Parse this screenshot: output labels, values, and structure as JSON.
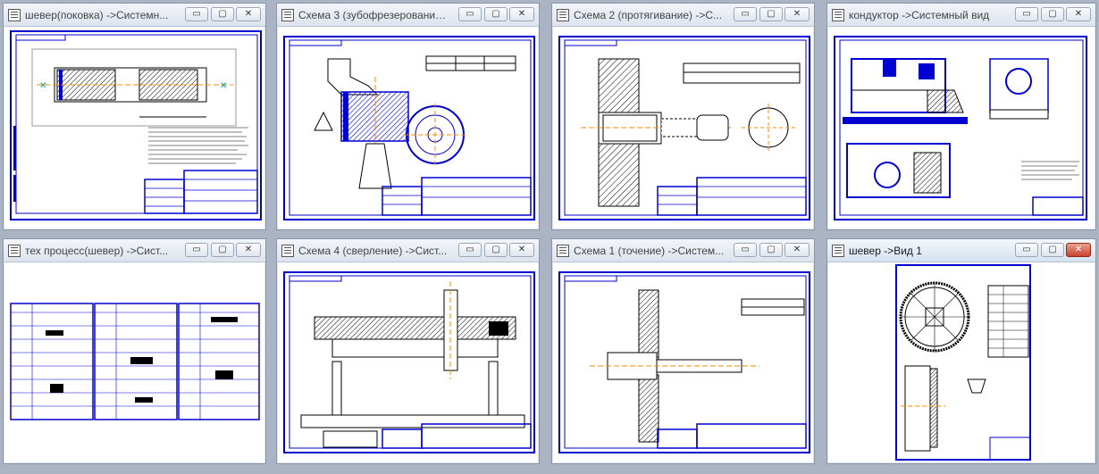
{
  "windows": [
    {
      "title": "шевер(поковка) ->Системн...",
      "drawing": "forging"
    },
    {
      "title": "Схема 3 (зубофрезерование...",
      "drawing": "hobbing"
    },
    {
      "title": "Схема 2 (протягивание) ->С...",
      "drawing": "broaching"
    },
    {
      "title": "кондуктор ->Системный вид",
      "drawing": "fixture"
    },
    {
      "title": "тех процесс(шевер) ->Сист...",
      "drawing": "process"
    },
    {
      "title": "Схема 4 (сверление) ->Сист...",
      "drawing": "drilling"
    },
    {
      "title": "Схема 1 (точение) ->Систем...",
      "drawing": "turning"
    },
    {
      "title": "шевер ->Вид 1",
      "drawing": "shaver"
    }
  ],
  "buttons": {
    "minimize": "▭",
    "maximize": "▢",
    "close": "✕"
  },
  "colors": {
    "frame": "#0000d0",
    "ink": "#000000",
    "accent": "#ff8800"
  }
}
